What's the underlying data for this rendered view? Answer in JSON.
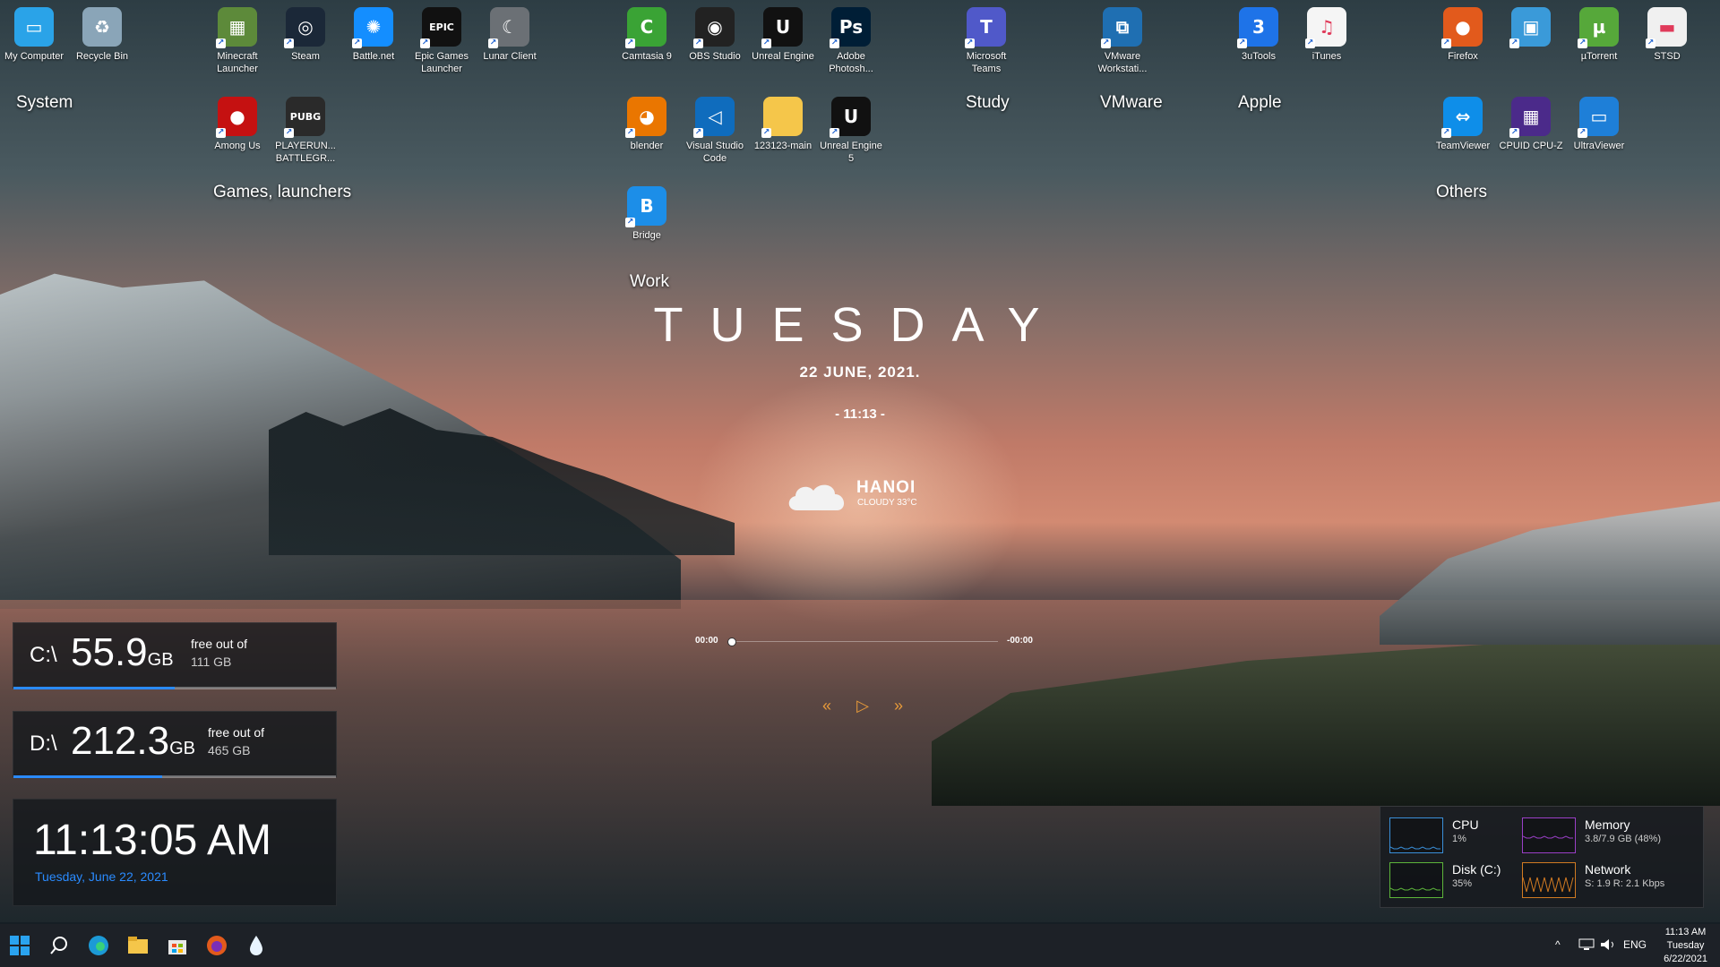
{
  "desktop_icons": [
    {
      "label": "My Computer",
      "icon": "monitor-icon",
      "color": "#2aa3e8",
      "glyph": "▭"
    },
    {
      "label": "Recycle Bin",
      "icon": "recycle-bin-icon",
      "color": "#8aa5b8",
      "glyph": "♻"
    },
    {
      "label": "Minecraft Launcher",
      "icon": "minecraft-icon",
      "color": "#5d8a3a",
      "glyph": "▦"
    },
    {
      "label": "Steam",
      "icon": "steam-icon",
      "color": "#1b2838",
      "glyph": "◎"
    },
    {
      "label": "Battle.net",
      "icon": "battlenet-icon",
      "color": "#148eff",
      "glyph": "✺"
    },
    {
      "label": "Epic Games Launcher",
      "icon": "epic-games-icon",
      "color": "#111111",
      "glyph": "EPIC"
    },
    {
      "label": "Lunar Client",
      "icon": "lunar-client-icon",
      "color": "#6b7075",
      "glyph": "☾"
    },
    {
      "label": "Camtasia 9",
      "icon": "camtasia-icon",
      "color": "#3aa335",
      "glyph": "C"
    },
    {
      "label": "OBS Studio",
      "icon": "obs-icon",
      "color": "#222222",
      "glyph": "◉"
    },
    {
      "label": "Unreal Engine",
      "icon": "unreal-engine-icon",
      "color": "#111111",
      "glyph": "U"
    },
    {
      "label": "Adobe Photosh...",
      "icon": "photoshop-icon",
      "color": "#001e36",
      "glyph": "Ps"
    },
    {
      "label": "Microsoft Teams",
      "icon": "teams-icon",
      "color": "#5059c9",
      "glyph": "T"
    },
    {
      "label": "VMware Workstati...",
      "icon": "vmware-icon",
      "color": "#1f6fb2",
      "glyph": "⧉"
    },
    {
      "label": "3uTools",
      "icon": "3utools-icon",
      "color": "#1e73e8",
      "glyph": "3"
    },
    {
      "label": "iTunes",
      "icon": "itunes-icon",
      "color": "#f5f5f5",
      "glyph": "♫"
    },
    {
      "label": "Firefox",
      "icon": "firefox-icon",
      "color": "#e25a1c",
      "glyph": "●"
    },
    {
      "label": "",
      "icon": "control-panel-icon",
      "color": "#3a9ad9",
      "glyph": "▣"
    },
    {
      "label": "µTorrent",
      "icon": "utorrent-icon",
      "color": "#56a83a",
      "glyph": "µ"
    },
    {
      "label": "STSD",
      "icon": "document-icon",
      "color": "#f0f0f0",
      "glyph": "▬"
    },
    {
      "label": "Among Us",
      "icon": "among-us-icon",
      "color": "#c51111",
      "glyph": "●"
    },
    {
      "label": "PLAYERUN... BATTLEGR...",
      "icon": "pubg-icon",
      "color": "#2a2a2a",
      "glyph": "PUBG"
    },
    {
      "label": "blender",
      "icon": "blender-icon",
      "color": "#ea7600",
      "glyph": "◕"
    },
    {
      "label": "Visual Studio Code",
      "icon": "vscode-icon",
      "color": "#0f6cbd",
      "glyph": "◁"
    },
    {
      "label": "123123-main",
      "icon": "folder-icon",
      "color": "#f5c64a",
      "glyph": ""
    },
    {
      "label": "Unreal Engine 5",
      "icon": "unreal-engine-5-icon",
      "color": "#111111",
      "glyph": "U"
    },
    {
      "label": "TeamViewer",
      "icon": "teamviewer-icon",
      "color": "#0e8ee9",
      "glyph": "⇔"
    },
    {
      "label": "CPUID CPU-Z",
      "icon": "cpuz-icon",
      "color": "#4b2a8a",
      "glyph": "▦"
    },
    {
      "label": "UltraViewer",
      "icon": "ultraviewer-icon",
      "color": "#1e7fd8",
      "glyph": "▭"
    },
    {
      "label": "Bridge",
      "icon": "adobe-bridge-icon",
      "color": "#1c8ee8",
      "glyph": "B"
    }
  ],
  "groups": {
    "system": "System",
    "games": "Games, launchers",
    "work": "Work",
    "study": "Study",
    "vmware": "VMware",
    "apple": "Apple",
    "others": "Others"
  },
  "center": {
    "day": "TUESDAY",
    "date": "22  JUNE,  2021.",
    "time": "- 11:13 -",
    "city": "HANOI",
    "weather": "CLOUDY 33°C"
  },
  "player": {
    "elapsed": "00:00",
    "remaining": "-00:00",
    "prev": "«",
    "play": "▷",
    "next": "»"
  },
  "drives": [
    {
      "letter": "C:\\",
      "free": "55.9",
      "unit": "GB",
      "label": "free out of",
      "total": "111 GB",
      "free_fraction": 0.5
    },
    {
      "letter": "D:\\",
      "free": "212.3",
      "unit": "GB",
      "label": "free out of",
      "total": "465 GB",
      "free_fraction": 0.46
    }
  ],
  "clock_widget": {
    "time": "11:13:05 AM",
    "date": "Tuesday, June 22, 2021"
  },
  "perf": [
    {
      "name": "CPU",
      "value": "1%",
      "color": "#3a8fd8"
    },
    {
      "name": "Memory",
      "value": "3.8/7.9 GB (48%)",
      "color": "#9a3fc7"
    },
    {
      "name": "Disk (C:)",
      "value": "35%",
      "color": "#5db53a"
    },
    {
      "name": "Network",
      "value": "S: 1.9 R: 2.1 Kbps",
      "color": "#d07a22"
    }
  ],
  "taskbar": {
    "apps": [
      "windows-start-icon",
      "search-icon",
      "edge-icon",
      "file-explorer-icon",
      "store-icon",
      "firefox-icon",
      "ink-drop-icon"
    ],
    "lang": "ENG",
    "tray_up": "^",
    "time": "11:13 AM",
    "day": "Tuesday",
    "date": "6/22/2021"
  }
}
